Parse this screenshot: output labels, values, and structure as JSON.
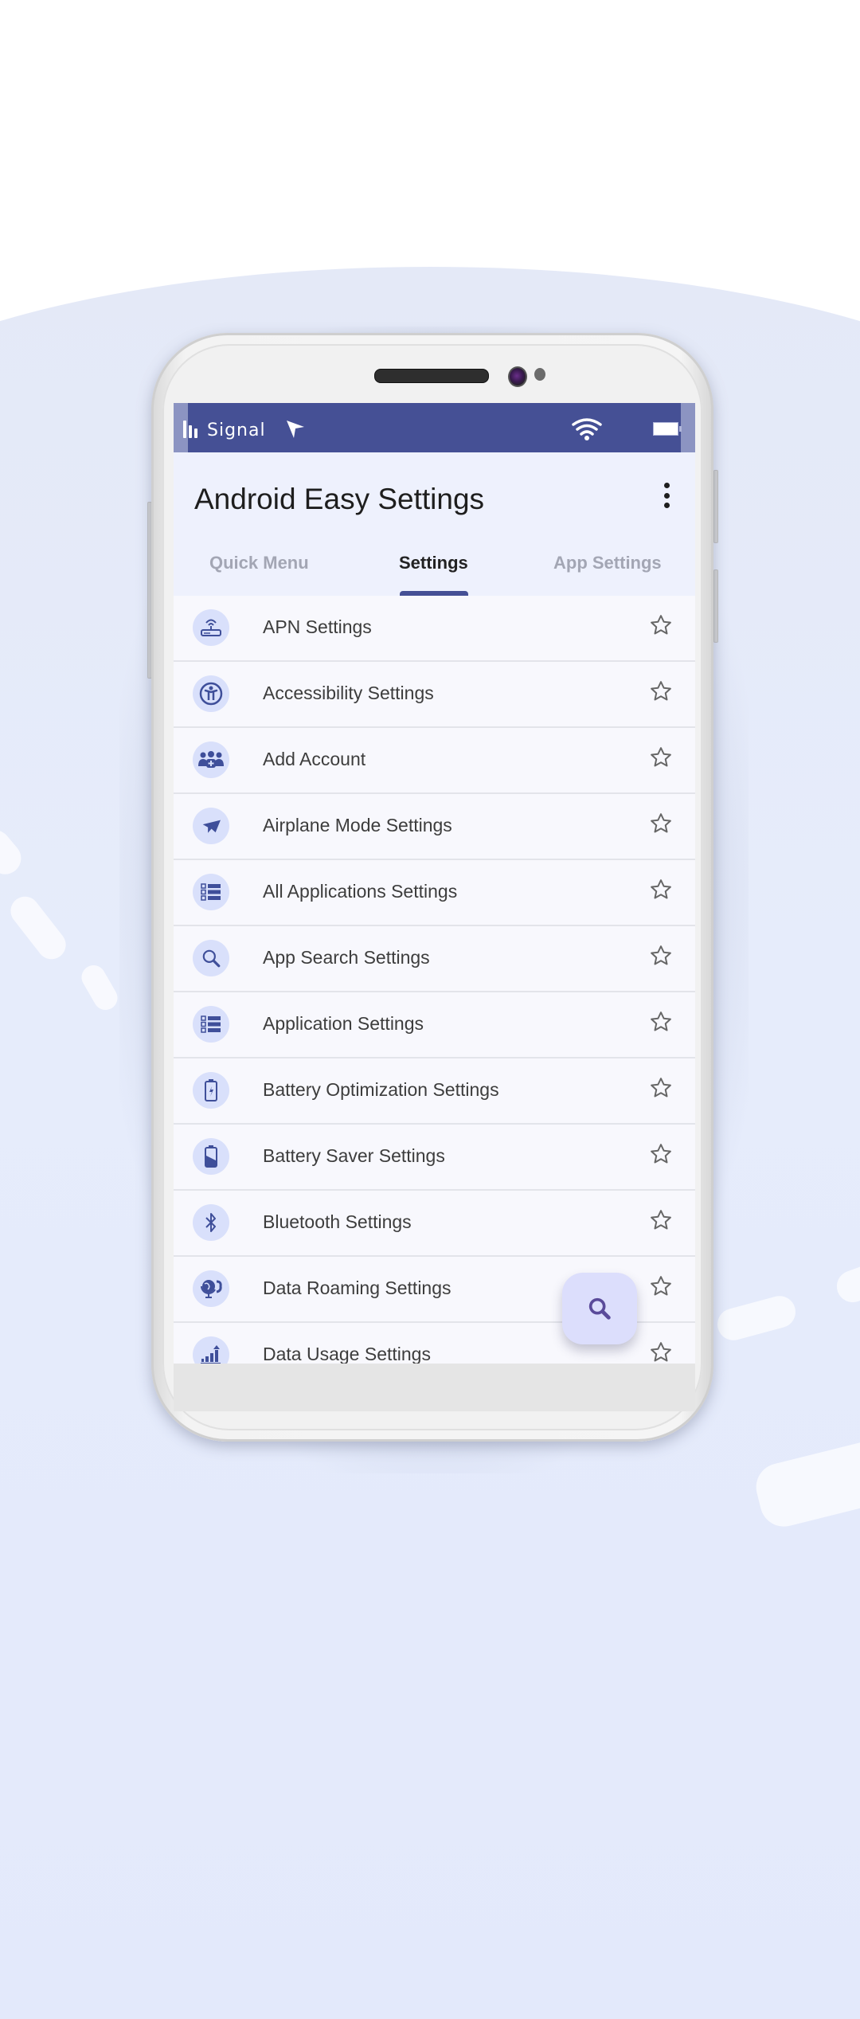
{
  "status_bar": {
    "carrier_label": "Signal",
    "icons": [
      "signal-bars-icon",
      "navigation-arrow-icon",
      "wifi-icon",
      "battery-icon"
    ]
  },
  "app_bar": {
    "title": "Android Easy Settings",
    "overflow_icon": "more-vert-icon"
  },
  "tabs": [
    {
      "label": "Quick Menu",
      "active": false
    },
    {
      "label": "Settings",
      "active": true
    },
    {
      "label": "App Settings",
      "active": false
    }
  ],
  "settings_list": [
    {
      "label": "APN Settings",
      "icon": "router-icon",
      "favorite": false
    },
    {
      "label": "Accessibility Settings",
      "icon": "accessibility-icon",
      "favorite": false
    },
    {
      "label": "Add Account",
      "icon": "add-account-icon",
      "favorite": false
    },
    {
      "label": "Airplane Mode Settings",
      "icon": "airplane-icon",
      "favorite": false
    },
    {
      "label": "All Applications Settings",
      "icon": "app-list-icon",
      "favorite": false
    },
    {
      "label": "App Search Settings",
      "icon": "search-icon",
      "favorite": false
    },
    {
      "label": "Application Settings",
      "icon": "app-list-icon",
      "favorite": false
    },
    {
      "label": "Battery Optimization Settings",
      "icon": "battery-charging-icon",
      "favorite": false
    },
    {
      "label": "Battery Saver Settings",
      "icon": "battery-saver-icon",
      "favorite": false
    },
    {
      "label": "Bluetooth Settings",
      "icon": "bluetooth-icon",
      "favorite": false
    },
    {
      "label": "Data Roaming Settings",
      "icon": "globe-phone-icon",
      "favorite": false
    },
    {
      "label": "Data Usage Settings",
      "icon": "data-usage-icon",
      "favorite": false
    }
  ],
  "fab": {
    "icon": "search-icon"
  },
  "colors": {
    "primary": "#455095",
    "header_bg": "#eef1fd",
    "icon_circle": "#d9e0fb",
    "icon_fg": "#3f4f9a",
    "fab_bg": "#dcdefc",
    "fab_icon": "#5a4a9a",
    "tab_inactive": "#a3a6b4"
  }
}
